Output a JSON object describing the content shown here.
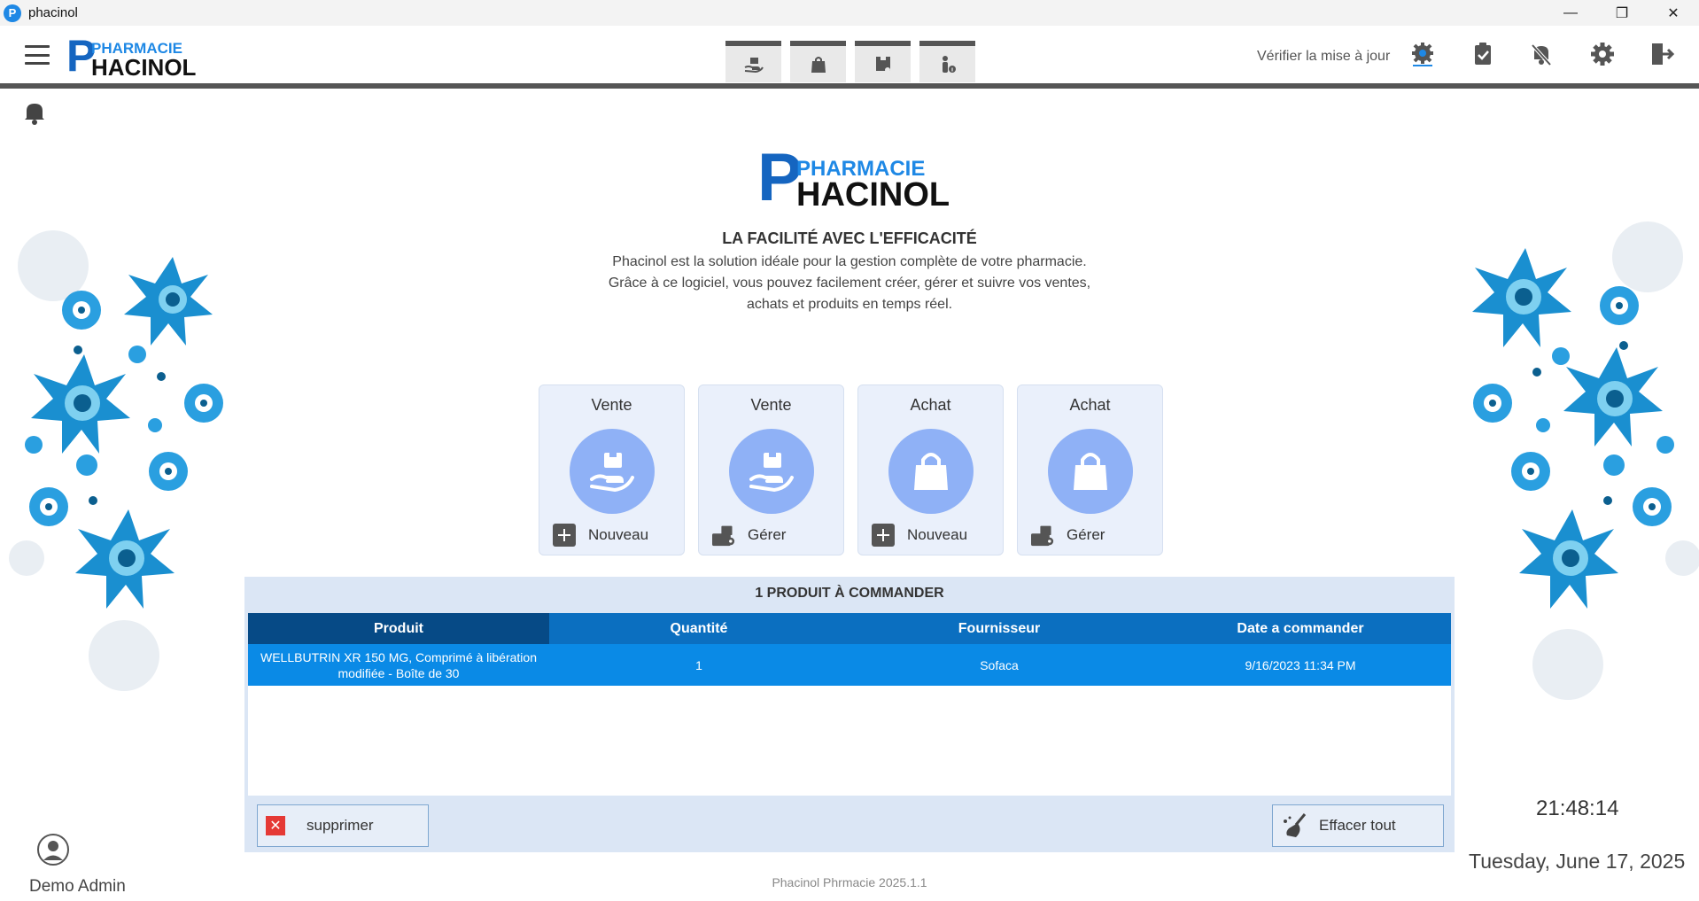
{
  "window": {
    "title": "phacinol",
    "app_icon_letter": "P",
    "controls": {
      "minimize": "—",
      "restore": "❐",
      "close": "✕"
    }
  },
  "logo": {
    "letter": "P",
    "line1": "PHARMACIE",
    "line2": "HACINOL"
  },
  "header": {
    "update_label": "Vérifier la mise à jour",
    "top_tabs": [
      {
        "icon": "hand-box-icon"
      },
      {
        "icon": "shopping-bag-icon"
      },
      {
        "icon": "box-cart-icon"
      },
      {
        "icon": "person-info-icon"
      }
    ],
    "right_icons": [
      "update-gear-icon",
      "clipboard-check-icon",
      "bell-off-icon",
      "settings-gear-icon",
      "logout-icon"
    ]
  },
  "hero": {
    "tagline": "LA FACILITÉ AVEC L'EFFICACITÉ",
    "description": "Phacinol est la solution idéale pour la gestion complète de votre pharmacie. Grâce à ce logiciel, vous pouvez facilement créer, gérer et suivre vos ventes, achats et produits en temps réel."
  },
  "cards": [
    {
      "title": "Vente",
      "action": "Nouveau",
      "icon": "hand-box-icon",
      "action_icon": "plus-icon"
    },
    {
      "title": "Vente",
      "action": "Gérer",
      "icon": "hand-box-icon",
      "action_icon": "manage-icon"
    },
    {
      "title": "Achat",
      "action": "Nouveau",
      "icon": "shopping-bag-icon",
      "action_icon": "plus-icon"
    },
    {
      "title": "Achat",
      "action": "Gérer",
      "icon": "shopping-bag-icon",
      "action_icon": "manage-icon"
    }
  ],
  "orders": {
    "title": "1 PRODUIT À COMMANDER",
    "columns": [
      "Produit",
      "Quantité",
      "Fournisseur",
      "Date a commander"
    ],
    "rows": [
      [
        "WELLBUTRIN XR 150 MG, Comprimé à libération modifiée - Boîte de 30",
        "1",
        "Sofaca",
        "9/16/2023 11:34 PM"
      ]
    ],
    "delete_label": "supprimer",
    "clear_label": "Effacer tout"
  },
  "footer": {
    "version": "Phacinol Phrmacie 2025.1.1",
    "time": "21:48:14",
    "date": "Tuesday, June 17, 2025",
    "user": "Demo Admin"
  },
  "colors": {
    "accent": "#0a8ae6",
    "header_dark": "#064a86",
    "header_blue": "#0b6fc0",
    "card_bg": "#eaf0fb",
    "card_circle": "#8fb1f6",
    "delete_red": "#e53935"
  }
}
